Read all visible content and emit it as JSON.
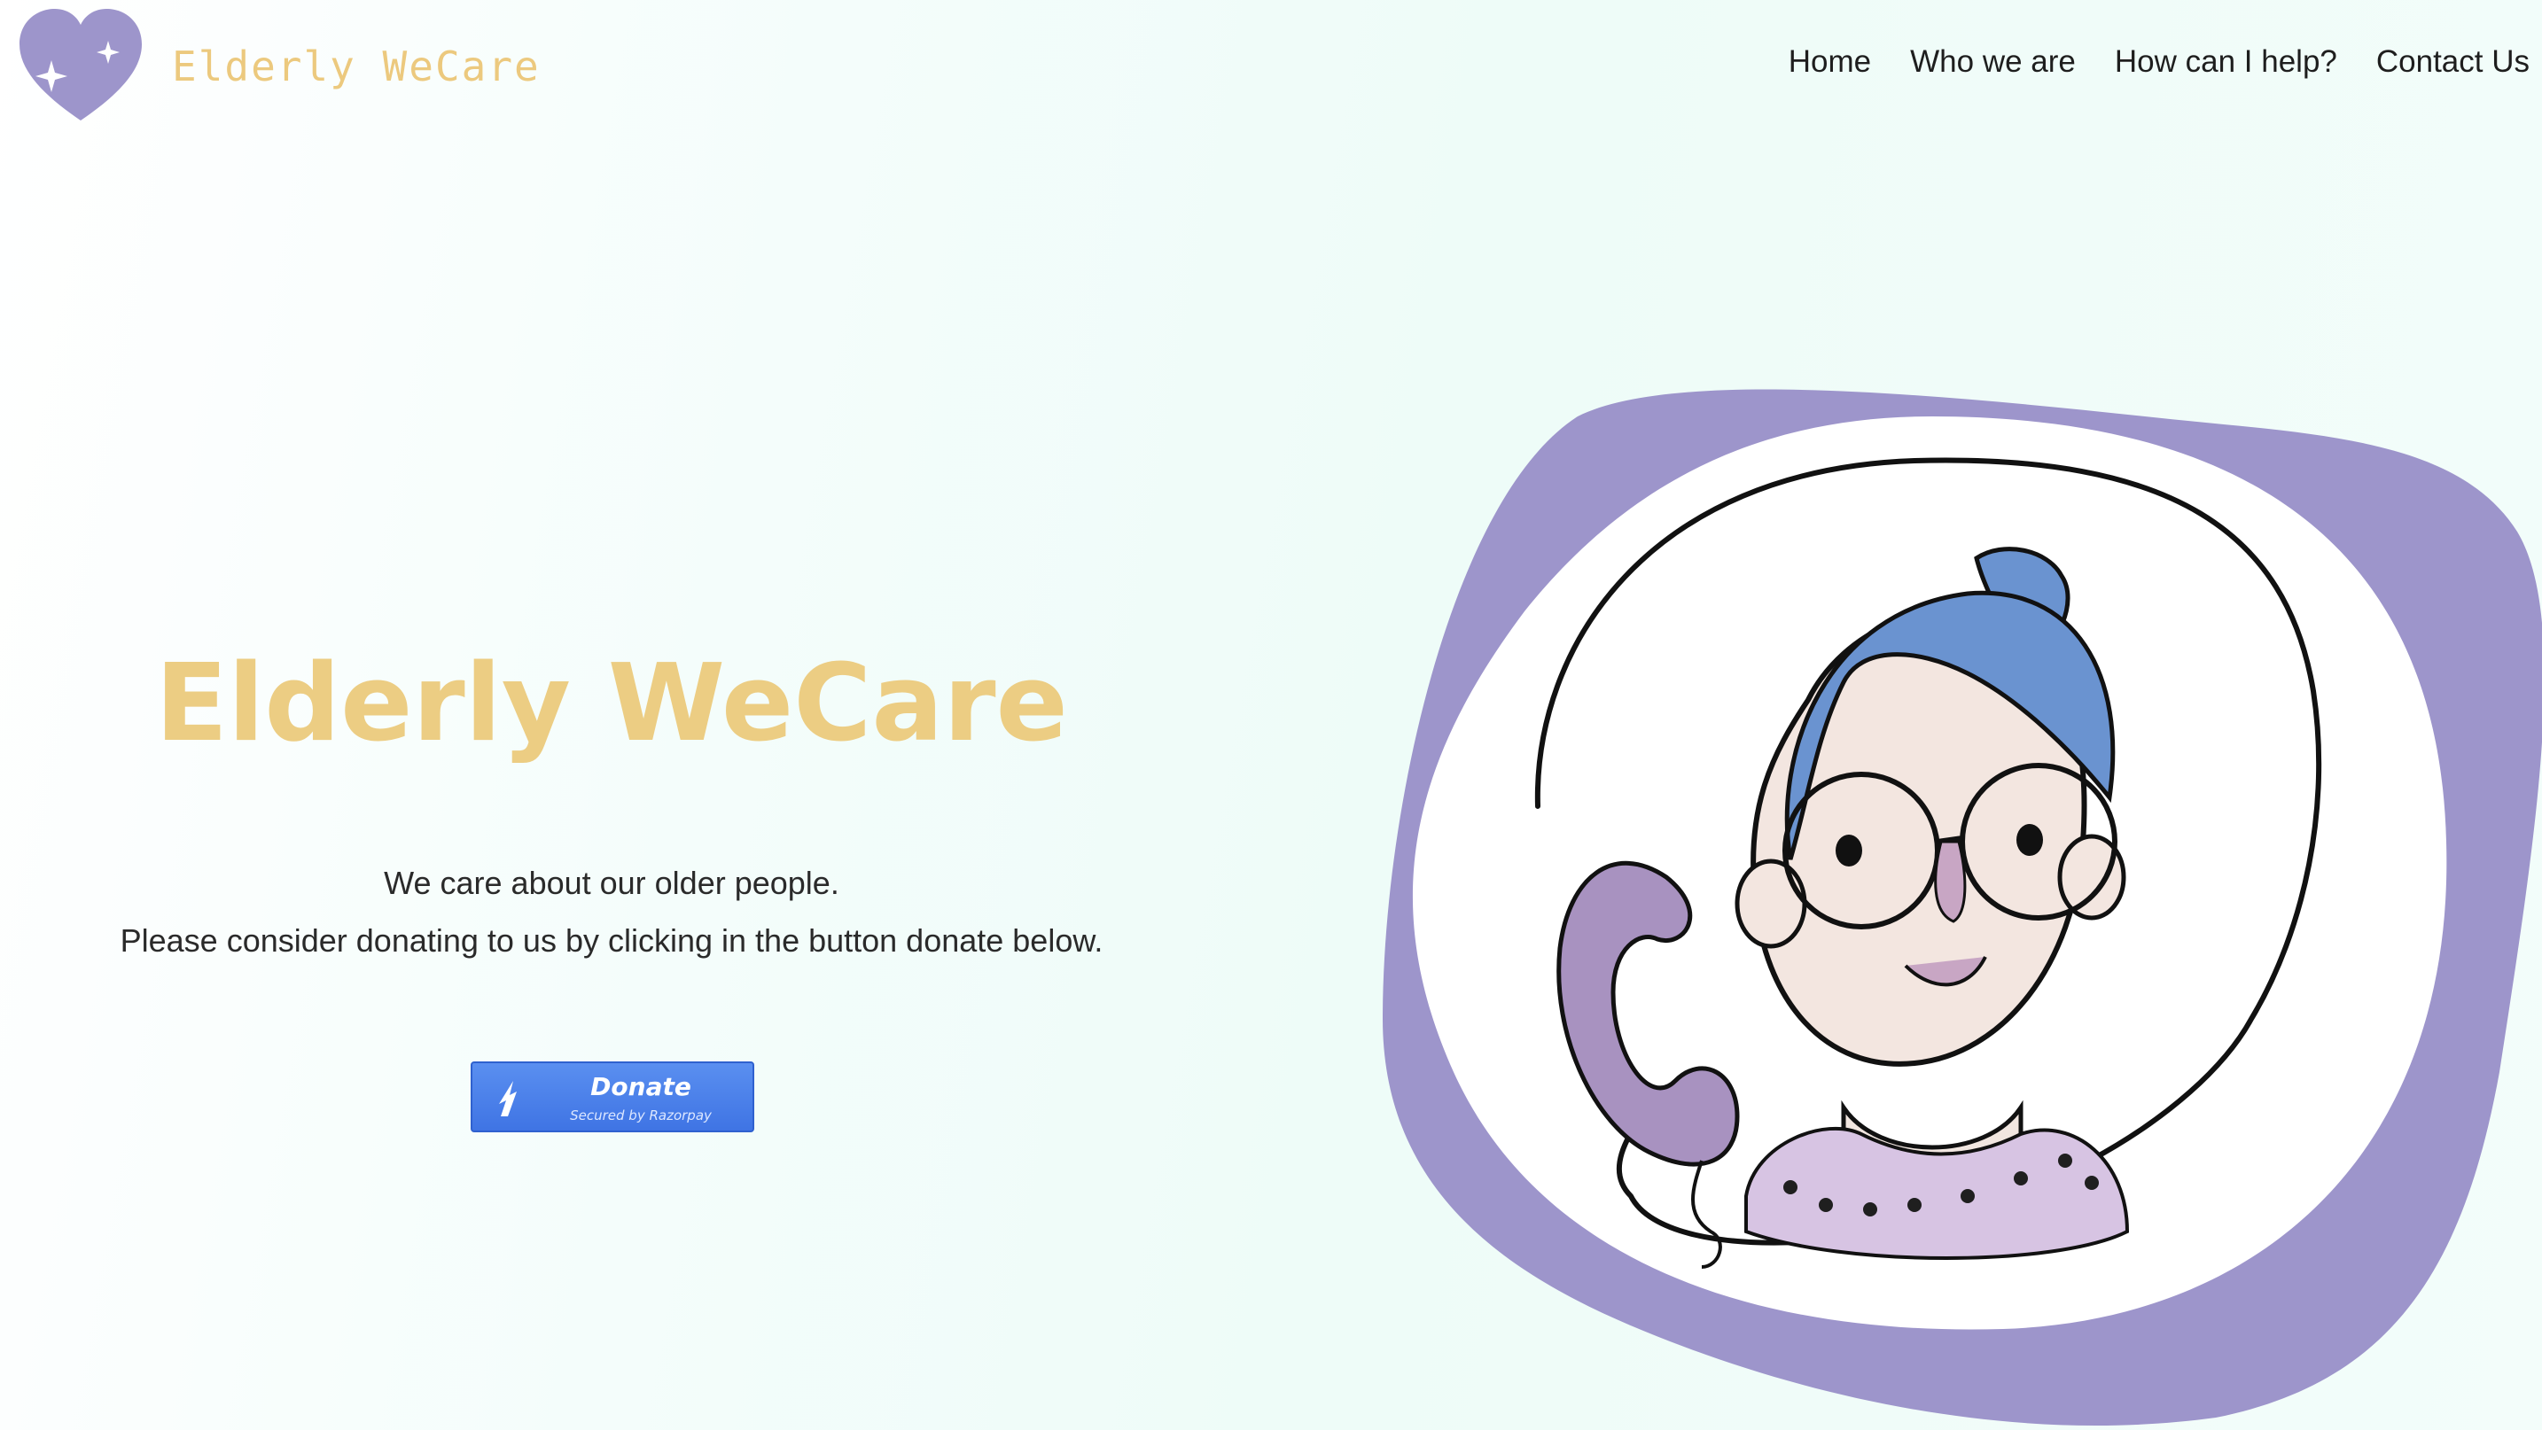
{
  "header": {
    "brand_name": "Elderly WeCare",
    "logo_icon": "heart-sparkle-logo",
    "nav": [
      {
        "label": "Home"
      },
      {
        "label": "Who we are"
      },
      {
        "label": "How can I help?"
      },
      {
        "label": "Contact Us"
      }
    ]
  },
  "hero": {
    "title": "Elderly WeCare",
    "line1": "We care about our older people.",
    "line2": "Please consider donating to us by clicking in the button donate below."
  },
  "donate": {
    "label": "Donate",
    "sublabel": "Secured by Razorpay",
    "icon": "razorpay-icon"
  },
  "illustration": {
    "icon": "elderly-woman-on-phone-illustration"
  },
  "colors": {
    "brand_gold": "#ecc97e",
    "brand_purple": "#9d95cb",
    "donate_blue": "#4a80ea",
    "background": "#eefcf8"
  }
}
